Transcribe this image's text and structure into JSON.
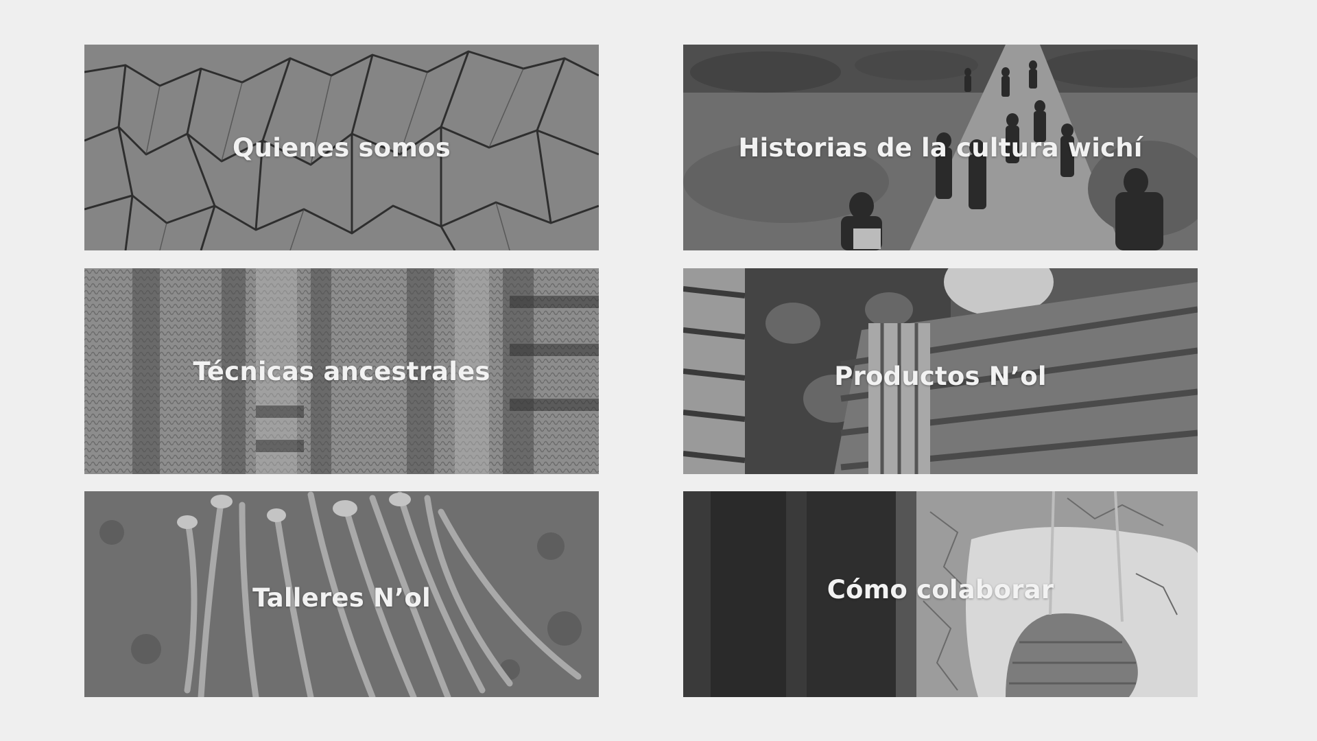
{
  "tiles": [
    {
      "title": "Quienes somos"
    },
    {
      "title": "Historias de la cultura wichí"
    },
    {
      "title": "Técnicas ancestrales"
    },
    {
      "title": "Productos N’ol"
    },
    {
      "title": "Talleres N’ol"
    },
    {
      "title": "Cómo colaborar"
    }
  ],
  "colors": {
    "page_background": "#efefef",
    "label_text": "#f2f2f2"
  }
}
